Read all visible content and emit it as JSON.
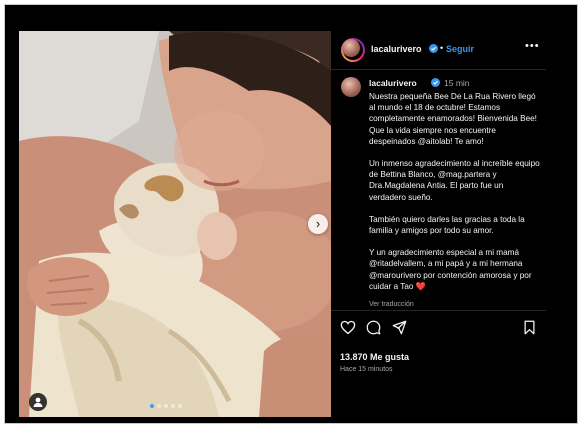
{
  "post": {
    "username": "lacalurivero",
    "follow_separator": "•",
    "follow_label": "Seguir",
    "more_icon": "more-horizontal-icon",
    "caption": {
      "username": "lacalurivero",
      "time": "15 min",
      "paragraphs": [
        "Nuestra pequeña Bee De La Rua Rivero llegó al mundo el 18 de octubre! Estamos completamente enamorados! Bienvenida Bee! Que la vida siempre nos encuentre despeinados @aitolab! Te amo!",
        "Un inmenso agradecimiento al increíble equipo de Bettina Blanco, @mag.partera y Dra.Magdalena Antia. El parto fue un verdadero sueño.",
        "También quiero darles las gracias a toda la familia y amigos por todo su amor.",
        "Y un agradecimiento especial a mi mamá @ritadelvallem, a mi papá y a mi hermana @marourivero por contención amorosa y por cuidar a Tao ❤️"
      ],
      "see_translation": "Ver traducción"
    },
    "likes": "13.870 Me gusta",
    "posted_ago": "Hace 15 minutos",
    "carousel": {
      "slides": 5,
      "active_index": 0
    },
    "icons": [
      "heart-icon",
      "comment-icon",
      "share-icon",
      "bookmark-icon",
      "tag-user-icon",
      "chevron-right-icon",
      "verified-badge-icon"
    ]
  }
}
